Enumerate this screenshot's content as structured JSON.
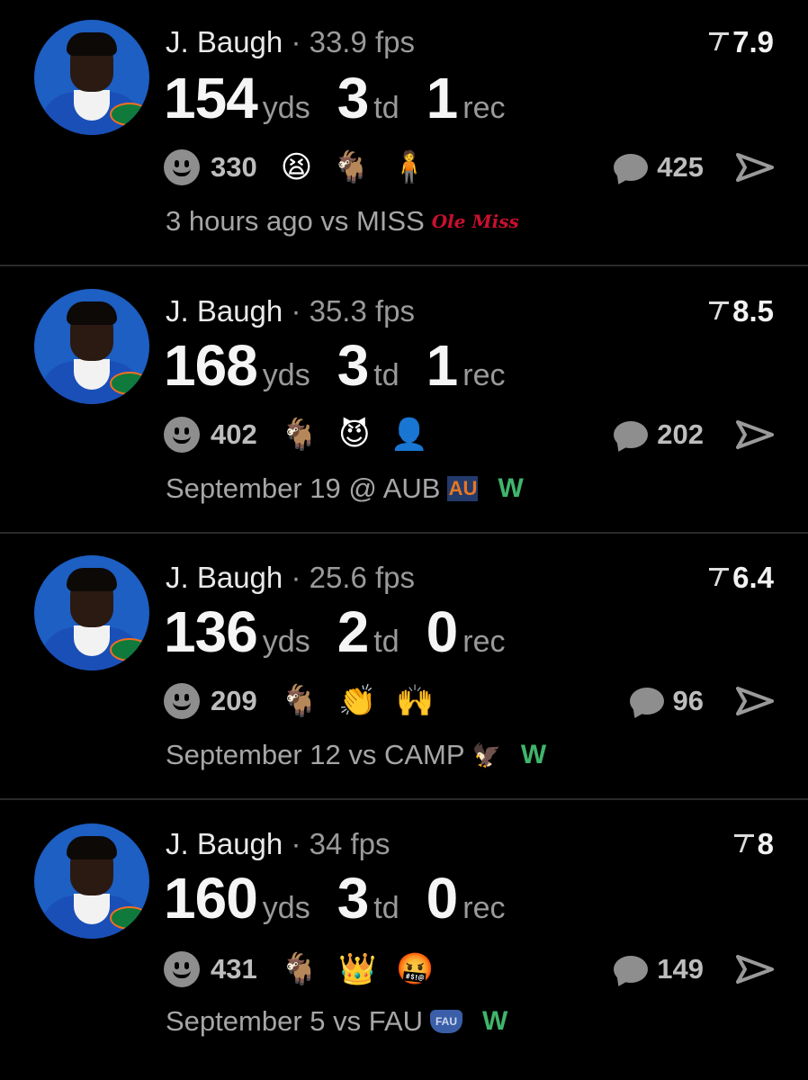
{
  "cards": [
    {
      "name": "J. Baugh",
      "fps": "· 33.9 fps",
      "rating": "7.9",
      "yds": "154",
      "yds_unit": "yds",
      "td": "3",
      "td_unit": "td",
      "rec": "1",
      "rec_unit": "rec",
      "reaction_count": "330",
      "emojis": [
        "😫",
        "🐐",
        "🧍"
      ],
      "comment_count": "425",
      "meta": "3 hours ago vs MISS",
      "team_logo": "Ole Miss",
      "result": ""
    },
    {
      "name": "J. Baugh",
      "fps": "· 35.3 fps",
      "rating": "8.5",
      "yds": "168",
      "yds_unit": "yds",
      "td": "3",
      "td_unit": "td",
      "rec": "1",
      "rec_unit": "rec",
      "reaction_count": "402",
      "emojis": [
        "🐐",
        "😈",
        "👤"
      ],
      "comment_count": "202",
      "meta": "September 19 @ AUB",
      "team_logo": "AU",
      "result": "W"
    },
    {
      "name": "J. Baugh",
      "fps": "· 25.6 fps",
      "rating": "6.4",
      "yds": "136",
      "yds_unit": "yds",
      "td": "2",
      "td_unit": "td",
      "rec": "0",
      "rec_unit": "rec",
      "reaction_count": "209",
      "emojis": [
        "🐐",
        "👏",
        "🙌"
      ],
      "comment_count": "96",
      "meta": "September 12 vs CAMP",
      "team_logo": "🦅",
      "result": "W"
    },
    {
      "name": "J. Baugh",
      "fps": "· 34 fps",
      "rating": "8",
      "yds": "160",
      "yds_unit": "yds",
      "td": "3",
      "td_unit": "td",
      "rec": "0",
      "rec_unit": "rec",
      "reaction_count": "431",
      "emojis": [
        "🐐",
        "👑",
        "🤬"
      ],
      "comment_count": "149",
      "meta": "September 5 vs FAU",
      "team_logo": "FAU",
      "result": "W"
    }
  ]
}
